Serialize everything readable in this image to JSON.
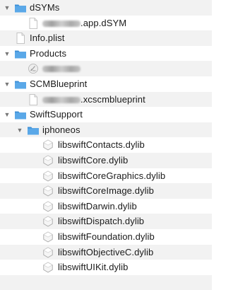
{
  "icons": {
    "folder": "folder-icon",
    "document": "document-icon",
    "app": "app-icon",
    "dylib": "dylib-icon"
  },
  "colors": {
    "folder": "#5aa8e8",
    "folder_tab": "#3d8fd6",
    "alt_row": "#f2f2f2"
  },
  "tree": {
    "dsyms_label": "dSYMs",
    "dsym_file_suffix": ".app.dSYM",
    "info_plist_label": "Info.plist",
    "products_label": "Products",
    "scmblueprint_folder_label": "SCMBlueprint",
    "scmblueprint_file_suffix": ".xcscmblueprint",
    "swiftsupport_label": "SwiftSupport",
    "iphoneos_label": "iphoneos",
    "dylibs": [
      "libswiftContacts.dylib",
      "libswiftCore.dylib",
      "libswiftCoreGraphics.dylib",
      "libswiftCoreImage.dylib",
      "libswiftDarwin.dylib",
      "libswiftDispatch.dylib",
      "libswiftFoundation.dylib",
      "libswiftObjectiveC.dylib",
      "libswiftUIKit.dylib"
    ]
  }
}
